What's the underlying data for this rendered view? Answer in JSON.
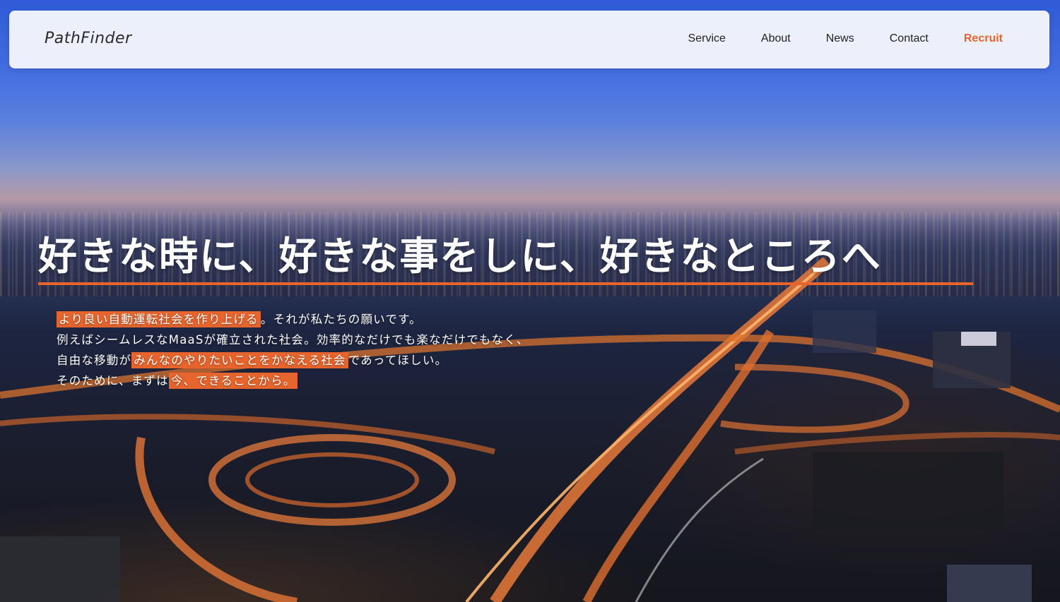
{
  "header": {
    "logo": "PathFinder",
    "nav": [
      {
        "label": "Service"
      },
      {
        "label": "About"
      },
      {
        "label": "News"
      },
      {
        "label": "Contact"
      },
      {
        "label": "Recruit"
      }
    ]
  },
  "hero": {
    "headline": "好きな時に、好きな事をしに、好きなところへ",
    "lines": [
      {
        "highlight_before": "",
        "highlight": "より良い自動運転社会を作り上げる",
        "after": "。それが私たちの願いです。"
      },
      {
        "highlight_before": "例えばシームレスなMaaSが確立された社会。効率的なだけでも楽なだけでもなく、",
        "highlight": "",
        "after": ""
      },
      {
        "highlight_before": "自由な移動が",
        "highlight": "みんなのやりたいことをかなえる社会",
        "after": "であってほしい。"
      },
      {
        "highlight_before": "そのために、まずは",
        "highlight": "今、できることから。",
        "after": ""
      }
    ]
  },
  "colors": {
    "accent": "#e7652d",
    "header_bg": "#f3f5fc",
    "text_dark": "#222222"
  }
}
